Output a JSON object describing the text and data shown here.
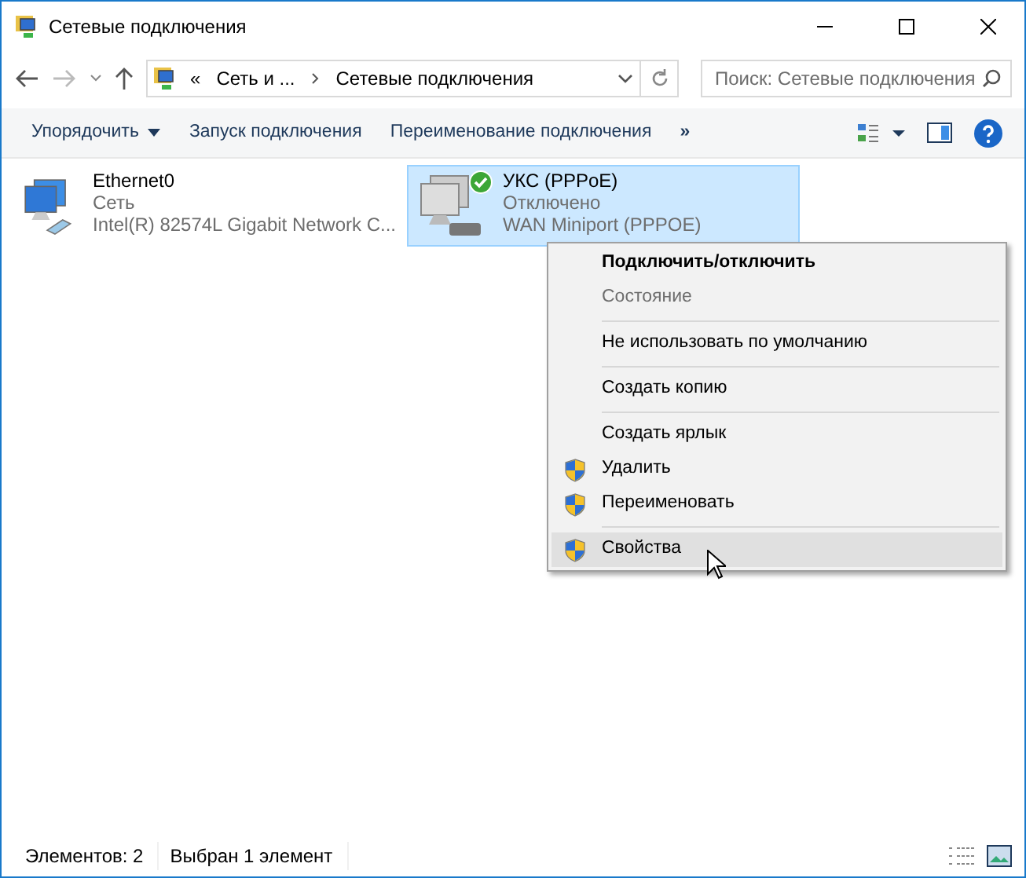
{
  "window": {
    "title": "Сетевые подключения"
  },
  "address": {
    "crumbs": [
      "«",
      "Сеть и ...",
      "Сетевые подключения"
    ]
  },
  "search": {
    "placeholder": "Поиск: Сетевые подключения"
  },
  "toolbar": {
    "items": [
      {
        "label": "Упорядочить",
        "dropdown": true
      },
      {
        "label": "Запуск подключения",
        "dropdown": false
      },
      {
        "label": "Переименование подключения",
        "dropdown": false
      }
    ],
    "more": "»"
  },
  "connections": [
    {
      "name": "Ethernet0",
      "status": "Сеть",
      "device": "Intel(R) 82574L Gigabit Network C...",
      "selected": false,
      "default": false
    },
    {
      "name": "УКС (PPPoE)",
      "status": "Отключено",
      "device": "WAN Miniport (PPPOE)",
      "selected": true,
      "default": true
    }
  ],
  "context_menu": [
    {
      "kind": "item",
      "label": "Подключить/отключить",
      "bold": true,
      "disabled": false,
      "shield": false,
      "selected": false
    },
    {
      "kind": "item",
      "label": "Состояние",
      "bold": false,
      "disabled": true,
      "shield": false,
      "selected": false
    },
    {
      "kind": "separator"
    },
    {
      "kind": "item",
      "label": "Не использовать по умолчанию",
      "bold": false,
      "disabled": false,
      "shield": false,
      "selected": false
    },
    {
      "kind": "separator"
    },
    {
      "kind": "item",
      "label": "Создать копию",
      "bold": false,
      "disabled": false,
      "shield": false,
      "selected": false
    },
    {
      "kind": "separator"
    },
    {
      "kind": "item",
      "label": "Создать ярлык",
      "bold": false,
      "disabled": false,
      "shield": false,
      "selected": false
    },
    {
      "kind": "item",
      "label": "Удалить",
      "bold": false,
      "disabled": false,
      "shield": true,
      "selected": false
    },
    {
      "kind": "item",
      "label": "Переименовать",
      "bold": false,
      "disabled": false,
      "shield": true,
      "selected": false
    },
    {
      "kind": "separator"
    },
    {
      "kind": "item",
      "label": "Свойства",
      "bold": false,
      "disabled": false,
      "shield": true,
      "selected": true
    }
  ],
  "status_bar": {
    "items": [
      "Элементов: 2",
      "Выбран 1 элемент"
    ]
  }
}
